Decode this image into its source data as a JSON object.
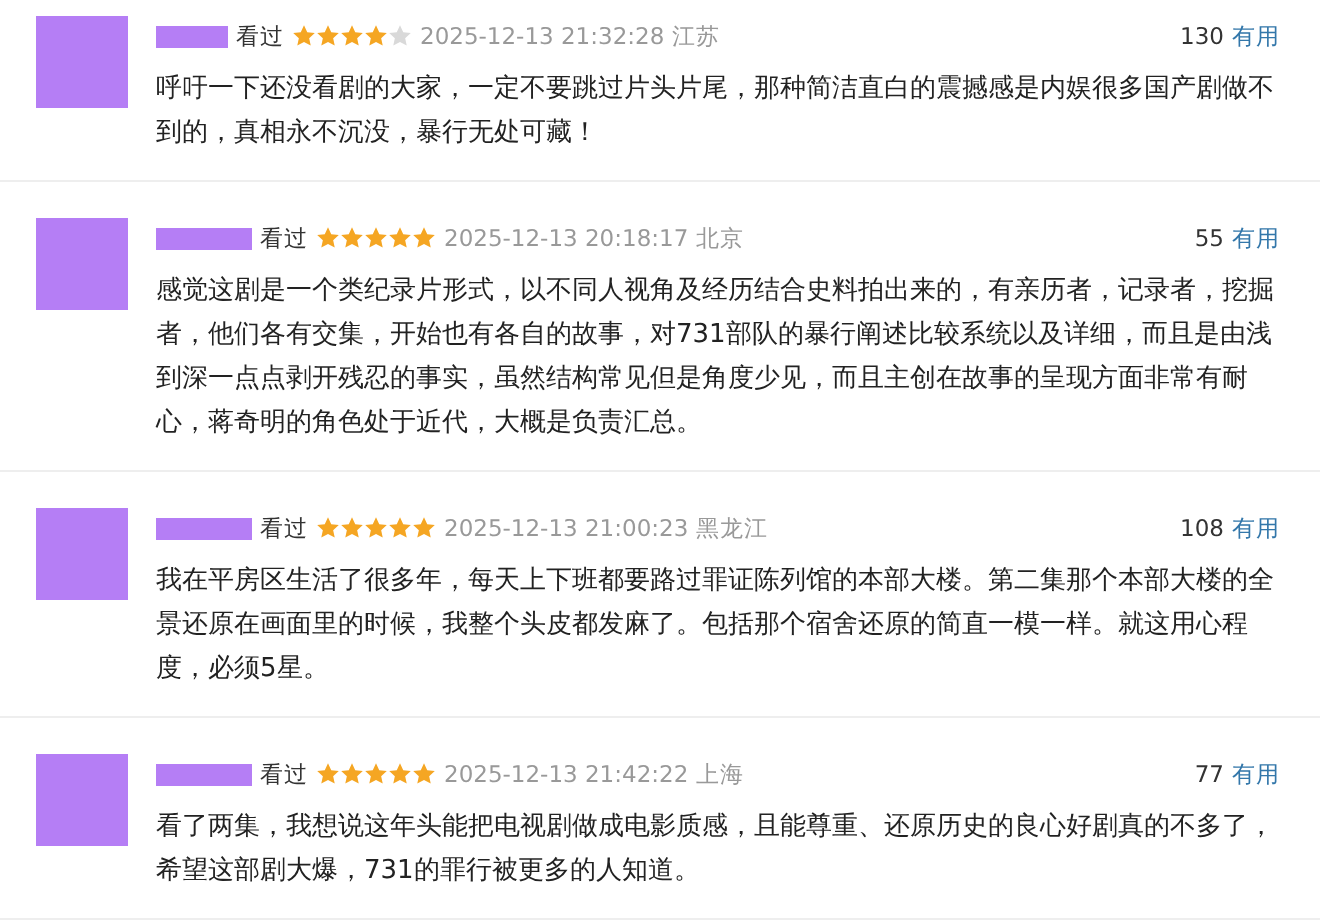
{
  "reviews": [
    {
      "status": "看过",
      "stars": 4,
      "time": "2025-12-13 21:32:28",
      "location": "江苏",
      "votes": "130",
      "useful": "有用",
      "text": "呼吁一下还没看剧的大家，一定不要跳过片头片尾，那种简洁直白的震撼感是内娱很多国产剧做不到的，真相永不沉没，暴行无处可藏！"
    },
    {
      "status": "看过",
      "stars": 5,
      "time": "2025-12-13 20:18:17",
      "location": "北京",
      "votes": "55",
      "useful": "有用",
      "text": "感觉这剧是一个类纪录片形式，以不同人视角及经历结合史料拍出来的，有亲历者，记录者，挖掘者，他们各有交集，开始也有各自的故事，对731部队的暴行阐述比较系统以及详细，而且是由浅到深一点点剥开残忍的事实，虽然结构常见但是角度少见，而且主创在故事的呈现方面非常有耐心，蒋奇明的角色处于近代，大概是负责汇总。"
    },
    {
      "status": "看过",
      "stars": 5,
      "time": "2025-12-13 21:00:23",
      "location": "黑龙江",
      "votes": "108",
      "useful": "有用",
      "text": "我在平房区生活了很多年，每天上下班都要路过罪证陈列馆的本部大楼。第二集那个本部大楼的全景还原在画面里的时候，我整个头皮都发麻了。包括那个宿舍还原的简直一模一样。就这用心程度，必须5星。"
    },
    {
      "status": "看过",
      "stars": 5,
      "time": "2025-12-13 21:42:22",
      "location": "上海",
      "votes": "77",
      "useful": "有用",
      "text": "看了两集，我想说这年头能把电视剧做成电影质感，且能尊重、还原历史的良心好剧真的不多了，希望这部剧大爆，731的罪行被更多的人知道。"
    }
  ]
}
